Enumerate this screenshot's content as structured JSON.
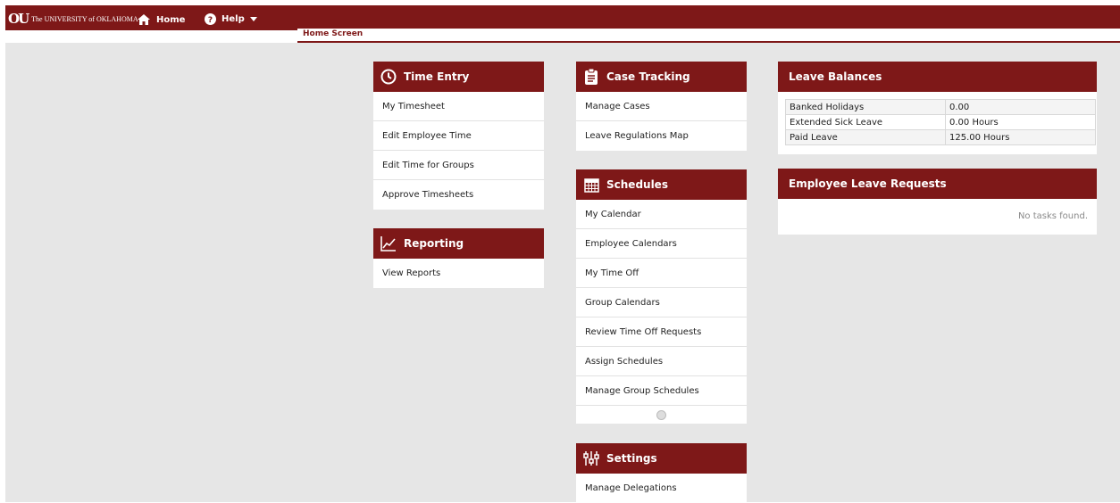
{
  "header": {
    "logo_mark": "OU",
    "logo_text": "The UNIVERSITY of OKLAHOMA",
    "home_label": "Home",
    "help_label": "Help",
    "brand_color": "#7e1818"
  },
  "tabs": [
    {
      "label": "Home Screen"
    }
  ],
  "time_entry": {
    "title": "Time Entry",
    "icon": "clock-icon",
    "items": [
      {
        "label": "My Timesheet"
      },
      {
        "label": "Edit Employee Time"
      },
      {
        "label": "Edit Time for Groups"
      },
      {
        "label": "Approve Timesheets"
      }
    ]
  },
  "reporting": {
    "title": "Reporting",
    "icon": "line-chart-icon",
    "items": [
      {
        "label": "View Reports"
      }
    ]
  },
  "case_tracking": {
    "title": "Case Tracking",
    "icon": "clipboard-icon",
    "items": [
      {
        "label": "Manage Cases"
      },
      {
        "label": "Leave Regulations Map"
      }
    ]
  },
  "schedules": {
    "title": "Schedules",
    "icon": "calendar-icon",
    "items": [
      {
        "label": "My Calendar"
      },
      {
        "label": "Employee Calendars"
      },
      {
        "label": "My Time Off"
      },
      {
        "label": "Group Calendars"
      },
      {
        "label": "Review Time Off Requests"
      },
      {
        "label": "Assign Schedules"
      },
      {
        "label": "Manage Group Schedules"
      }
    ]
  },
  "settings": {
    "title": "Settings",
    "icon": "sliders-icon",
    "items": [
      {
        "label": "Manage Delegations"
      }
    ]
  },
  "leave_balances": {
    "title": "Leave Balances",
    "rows": [
      {
        "name": "Banked Holidays",
        "value": "0.00"
      },
      {
        "name": "Extended Sick Leave",
        "value": "0.00 Hours"
      },
      {
        "name": "Paid Leave",
        "value": "125.00 Hours"
      }
    ]
  },
  "leave_requests": {
    "title": "Employee Leave Requests",
    "empty_text": "No tasks found."
  }
}
